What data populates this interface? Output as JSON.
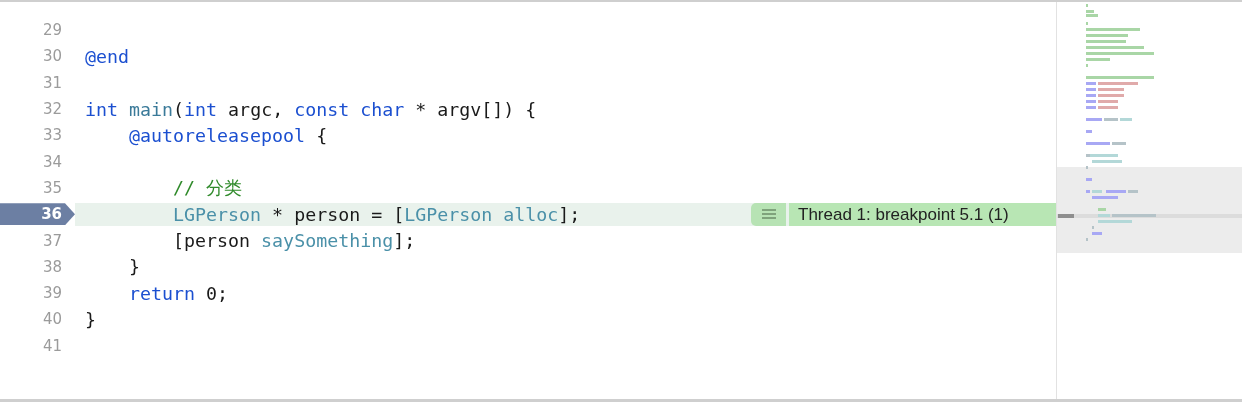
{
  "lines": [
    {
      "number": "29",
      "breakpoint": false,
      "current": false
    },
    {
      "number": "30",
      "breakpoint": false,
      "current": false,
      "tokens": [
        {
          "kind": "keyword",
          "text": "@end"
        }
      ]
    },
    {
      "number": "31",
      "breakpoint": false,
      "current": false
    },
    {
      "number": "32",
      "breakpoint": false,
      "current": false,
      "tokens": [
        {
          "kind": "keyword",
          "text": "int"
        },
        {
          "kind": "function",
          "text": " main"
        },
        {
          "kind": "plain",
          "text": "("
        },
        {
          "kind": "keyword",
          "text": "int"
        },
        {
          "kind": "plain",
          "text": " argc, "
        },
        {
          "kind": "keyword",
          "text": "const"
        },
        {
          "kind": "keyword",
          "text": " char"
        },
        {
          "kind": "plain",
          "text": " * argv[]) {"
        }
      ]
    },
    {
      "number": "33",
      "breakpoint": false,
      "current": false,
      "tokens": [
        {
          "kind": "keyword",
          "text": "    @autoreleasepool"
        },
        {
          "kind": "plain",
          "text": " {"
        }
      ]
    },
    {
      "number": "34",
      "breakpoint": false,
      "current": false
    },
    {
      "number": "35",
      "breakpoint": false,
      "current": false,
      "tokens": [
        {
          "kind": "comment",
          "text": "        // 分类"
        }
      ]
    },
    {
      "number": "36",
      "breakpoint": true,
      "current": true,
      "annotation": "Thread 1: breakpoint 5.1 (1)",
      "tokens": [
        {
          "kind": "type",
          "text": "        LGPerson"
        },
        {
          "kind": "plain",
          "text": " * person = ["
        },
        {
          "kind": "type",
          "text": "LGPerson"
        },
        {
          "kind": "type",
          "text": " alloc"
        },
        {
          "kind": "plain",
          "text": "];"
        }
      ]
    },
    {
      "number": "37",
      "breakpoint": false,
      "current": false,
      "tokens": [
        {
          "kind": "plain",
          "text": "        [person "
        },
        {
          "kind": "type",
          "text": "saySomething"
        },
        {
          "kind": "plain",
          "text": "];"
        }
      ]
    },
    {
      "number": "38",
      "breakpoint": false,
      "current": false,
      "tokens": [
        {
          "kind": "plain",
          "text": "    }"
        }
      ]
    },
    {
      "number": "39",
      "breakpoint": false,
      "current": false,
      "tokens": [
        {
          "kind": "keyword",
          "text": "    return"
        },
        {
          "kind": "plain",
          "text": " 0;"
        }
      ]
    },
    {
      "number": "40",
      "breakpoint": false,
      "current": false,
      "tokens": [
        {
          "kind": "plain",
          "text": "}"
        }
      ]
    },
    {
      "number": "41",
      "breakpoint": false,
      "current": false
    }
  ]
}
